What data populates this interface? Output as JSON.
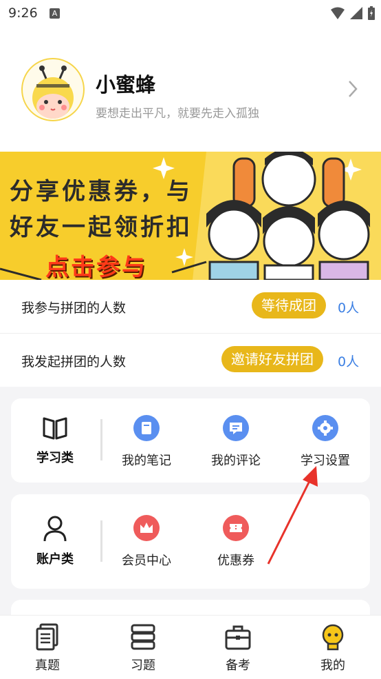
{
  "status_bar": {
    "time": "9:26",
    "notif_icon": "A"
  },
  "profile": {
    "name": "小蜜蜂",
    "motto": "要想走出平凡，就要先走入孤独"
  },
  "banner": {
    "line1": "分享优惠券，与",
    "line2": "好友一起领折扣",
    "cta": "点击参与"
  },
  "group_rows": [
    {
      "label": "我参与拼团的人数",
      "button": "等待成团",
      "count": "0人"
    },
    {
      "label": "我发起拼团的人数",
      "button": "邀请好友拼团",
      "count": "0人"
    }
  ],
  "study": {
    "category": "学习类",
    "items": [
      {
        "label": "我的笔记",
        "icon": "notebook-icon",
        "color": "#5a8ff0"
      },
      {
        "label": "我的评论",
        "icon": "comment-icon",
        "color": "#5a8ff0"
      },
      {
        "label": "学习设置",
        "icon": "gear-icon",
        "color": "#5a8ff0"
      }
    ]
  },
  "account": {
    "category": "账户类",
    "items": [
      {
        "label": "会员中心",
        "icon": "crown-icon",
        "color": "#ef5b5b"
      },
      {
        "label": "优惠券",
        "icon": "ticket-icon",
        "color": "#ef5b5b"
      }
    ]
  },
  "bottom_nav": [
    {
      "label": "真题",
      "icon": "papers-icon"
    },
    {
      "label": "习题",
      "icon": "books-icon"
    },
    {
      "label": "备考",
      "icon": "briefcase-icon"
    },
    {
      "label": "我的",
      "icon": "bee-icon",
      "active": true
    }
  ],
  "colors": {
    "accent_yellow": "#e8b71a",
    "count_blue": "#3b7fe3",
    "annotation_red": "#e8322a"
  }
}
